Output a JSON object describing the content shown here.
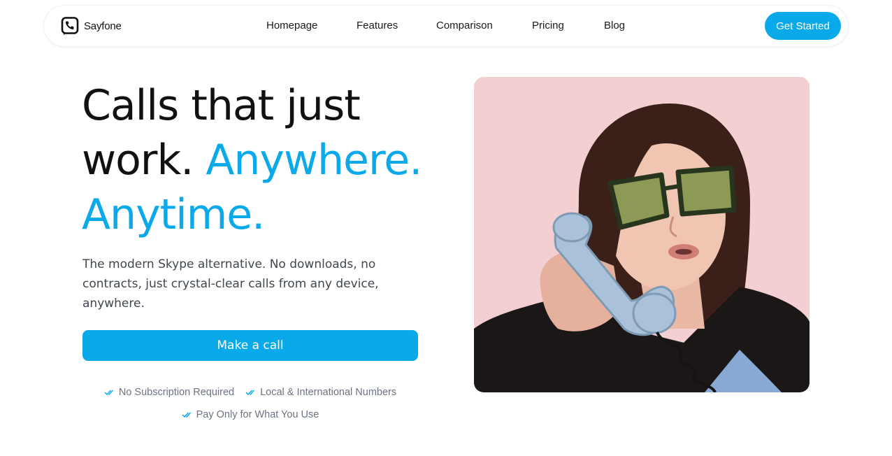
{
  "brand": {
    "name": "Sayfone",
    "logo_icon": "phone-logo-icon"
  },
  "nav": {
    "links": [
      "Homepage",
      "Features",
      "Comparison",
      "Pricing",
      "Blog"
    ],
    "cta_label": "Get Started"
  },
  "hero": {
    "headline_line1": "Calls that just",
    "headline_line2_dark": "work.",
    "headline_line2_accent": "Anywhere.",
    "headline_line3_accent": "Anytime.",
    "subtext": "The modern Skype alternative. No downloads, no contracts, just crystal-clear calls from any device, anywhere.",
    "cta_label": "Make a call",
    "features": [
      "No Subscription Required",
      "Local & International Numbers",
      "Pay Only for What You Use"
    ],
    "photo": "woman in square sunglasses holding a blue retro telephone handset"
  },
  "colors": {
    "accent": "#0aaaea",
    "text_dark": "#111111",
    "text_body": "#404650",
    "text_muted": "#6b7280",
    "photo_background": "#f3cfd2"
  }
}
